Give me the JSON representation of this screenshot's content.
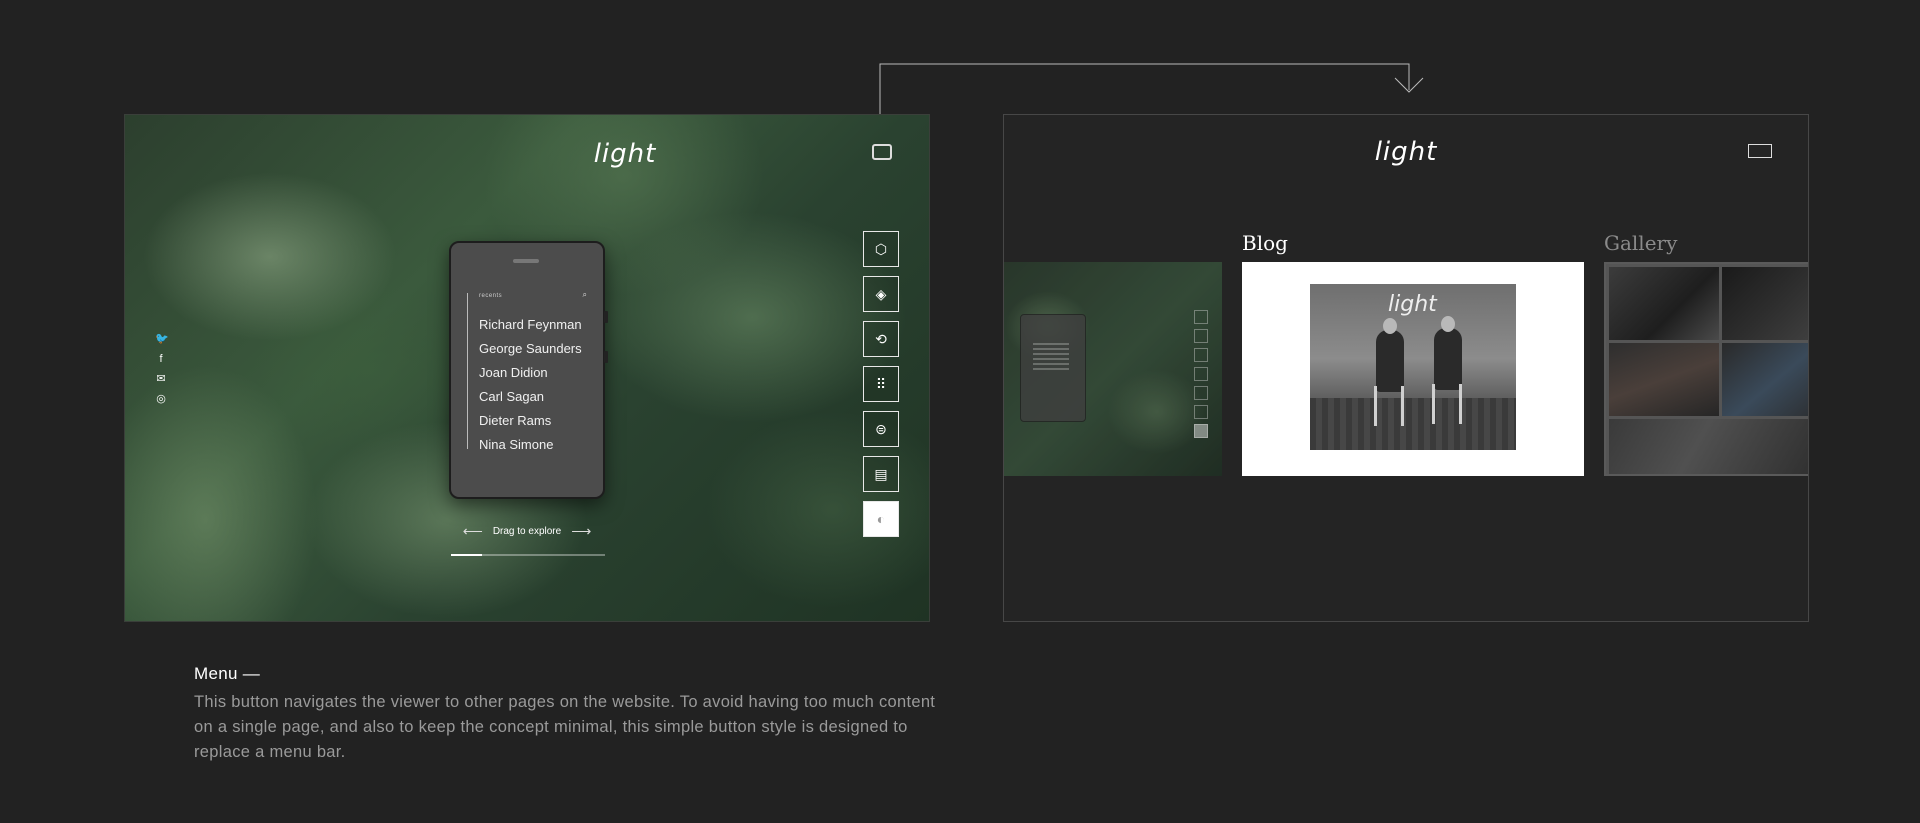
{
  "home": {
    "logo": "light",
    "menu_icon": "menu-square-icon",
    "social_icons": [
      "twitter-icon",
      "facebook-icon",
      "mail-icon",
      "instagram-icon"
    ],
    "phone": {
      "recents_label": "recents",
      "search_icon": "search-icon",
      "names": [
        "Richard Feynman",
        "George Saunders",
        "Joan Didion",
        "Carl Sagan",
        "Dieter Rams",
        "Nina Simone"
      ]
    },
    "drag_label": "Drag to explore",
    "progress": 0.2,
    "side_icons": [
      "cube-dimensions-icon",
      "cube-layers-icon",
      "cube-rotate-icon",
      "keypad-icon",
      "toggle-icon",
      "chat-icon",
      "contrast-icon"
    ]
  },
  "menu_page": {
    "logo": "light",
    "sections": {
      "blog": "Blog",
      "gallery": "Gallery"
    },
    "blog_image_text": "light"
  },
  "caption": {
    "title": "Menu  —",
    "body": "This button navigates the viewer to other pages on the website. To avoid having too much content on a single page, and also to keep the concept minimal, this simple button style is designed to replace a menu bar."
  },
  "colors": {
    "background": "#222222",
    "caption_text": "#9a9a9a",
    "connector": "#bbbbbb"
  }
}
